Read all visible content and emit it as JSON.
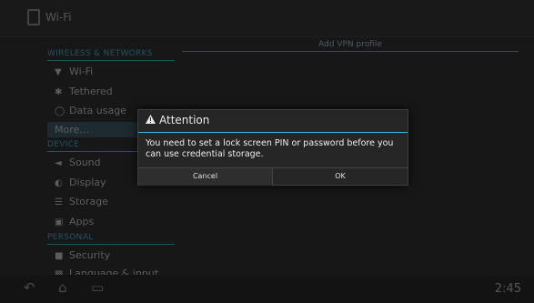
{
  "app_title": "Wi-Fi",
  "sidebar": {
    "section_wireless": "WIRELESS & NETWORKS",
    "section_device": "DEVICE",
    "section_personal": "PERSONAL",
    "items": [
      {
        "label": "Wi-Fi",
        "icon": "wifi-icon"
      },
      {
        "label": "Tethered",
        "icon": "bluetooth-icon"
      },
      {
        "label": "Data usage",
        "icon": "data-usage-icon"
      },
      {
        "label": "More...",
        "icon": ""
      },
      {
        "label": "Sound",
        "icon": "speaker-icon"
      },
      {
        "label": "Display",
        "icon": "display-icon"
      },
      {
        "label": "Storage",
        "icon": "storage-icon"
      },
      {
        "label": "Apps",
        "icon": "apps-icon"
      },
      {
        "label": "Security",
        "icon": "lock-icon"
      },
      {
        "label": "Language & input",
        "icon": "keyboard-icon"
      }
    ]
  },
  "content": {
    "header": "Add VPN profile"
  },
  "dialog": {
    "title": "Attention",
    "message": "You need to set a lock screen PIN or password before you can use credential storage.",
    "cancel_label": "Cancel",
    "ok_label": "OK"
  },
  "navbar": {
    "time": "2:45"
  },
  "colors": {
    "accent": "#33b5e5",
    "background": "#171717"
  }
}
